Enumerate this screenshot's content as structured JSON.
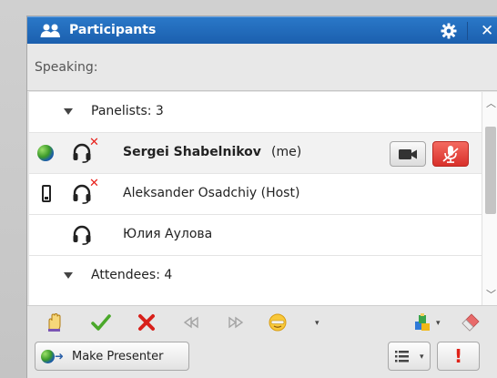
{
  "header": {
    "title": "Participants",
    "icon": "people-icon",
    "settings_icon": "gear-icon",
    "close_label": "✕"
  },
  "speaking": {
    "label": "Speaking:"
  },
  "groups": [
    {
      "label": "Panelists: 3",
      "expanded": true
    },
    {
      "label": "Attendees: 4",
      "expanded": true
    }
  ],
  "participants": [
    {
      "name": "Sergei Shabelnikov",
      "suffix": "(me)",
      "device": "globe-icon",
      "audio_muted": true,
      "selected": true
    },
    {
      "name": "Aleksander Osadchiy (Host)",
      "device": "phone-icon",
      "audio_muted": true,
      "selected": false
    },
    {
      "name": "Юлия Аулова",
      "device": "",
      "audio_muted": false,
      "selected": false
    }
  ],
  "toolbar": {
    "icons": [
      "raise-hand-icon",
      "yes-check-icon",
      "no-x-icon",
      "rewind-icon",
      "fast-forward-icon",
      "emoticon-icon",
      "annotate-icon",
      "eraser-icon"
    ]
  },
  "footer": {
    "make_presenter_label": "Make Presenter",
    "list_options_icon": "list-icon",
    "alert_label": "!"
  },
  "colors": {
    "titlebar": "#1b5fae",
    "muted_red": "#e8201a",
    "mic_button": "#d8302a"
  }
}
